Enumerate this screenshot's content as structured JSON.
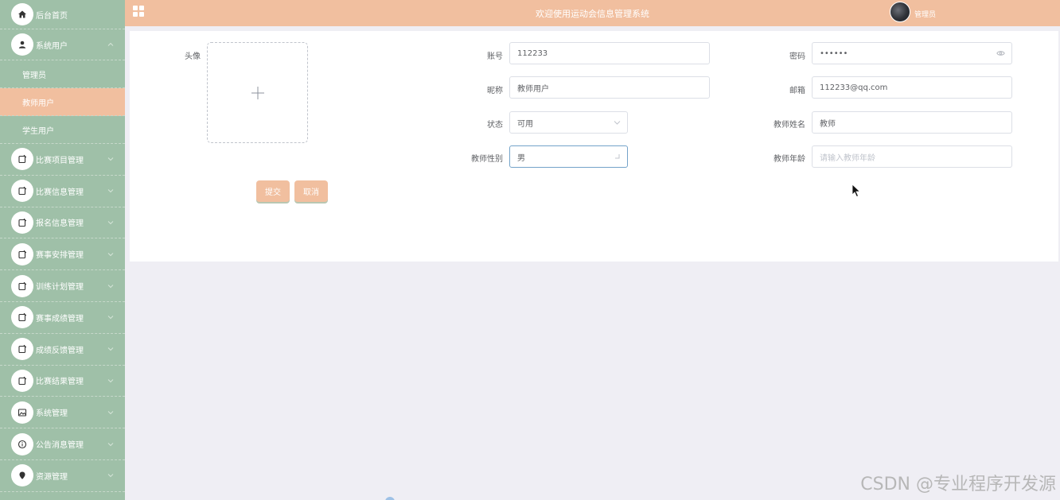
{
  "sidebar": {
    "home": "后台首页",
    "system_users": "系统用户",
    "sub_items": [
      "管理员",
      "教师用户",
      "学生用户"
    ],
    "items": [
      "比赛项目管理",
      "比赛信息管理",
      "报名信息管理",
      "赛事安排管理",
      "训练计划管理",
      "赛事成绩管理",
      "成绩反馈管理",
      "比赛结果管理",
      "系统管理",
      "公告消息管理",
      "资源管理"
    ]
  },
  "header": {
    "title": "欢迎使用运动会信息管理系统",
    "user": "管理员"
  },
  "form": {
    "avatar_label": "头像",
    "account_label": "账号",
    "account_value": "112233",
    "password_label": "密码",
    "password_value": "••••••",
    "nickname_label": "昵称",
    "nickname_value": "教师用户",
    "email_label": "邮箱",
    "email_value": "112233@qq.com",
    "status_label": "状态",
    "status_value": "可用",
    "name_label": "教师姓名",
    "name_value": "教师",
    "gender_label": "教师性别",
    "gender_value": "男",
    "age_label": "教师年龄",
    "age_placeholder": "请输入教师年龄",
    "submit": "提交",
    "cancel": "取消"
  },
  "watermark": "CSDN @专业程序开发源",
  "colors": {
    "sidebar": "#9fc0a8",
    "accent": "#f1bf9f",
    "background": "#efeef4"
  }
}
